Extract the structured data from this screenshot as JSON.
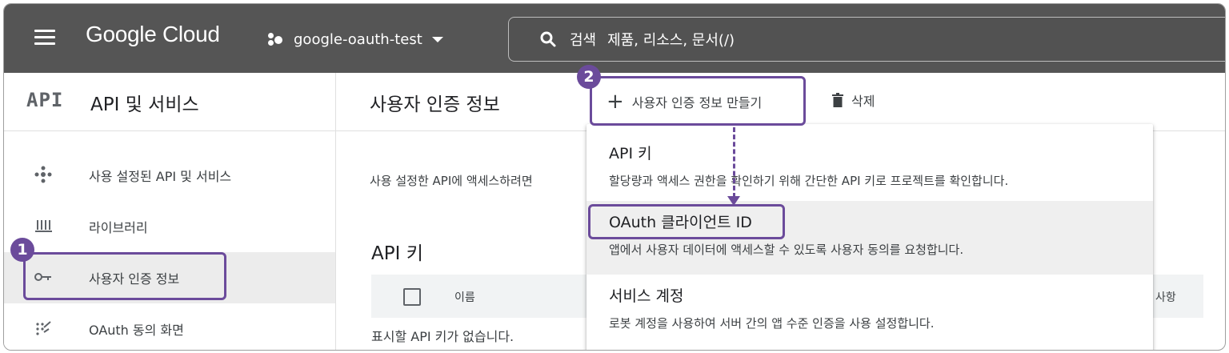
{
  "topbar": {
    "brand": "Google Cloud",
    "project": "google-oauth-test",
    "search_prefix": "검색",
    "search_placeholder": "제품, 리소스, 문서(/)"
  },
  "sidebar": {
    "logo": "API",
    "title": "API 및 서비스",
    "items": [
      {
        "label": "사용 설정된 API 및 서비스",
        "icon": "diamond-icon"
      },
      {
        "label": "라이브러리",
        "icon": "library-icon"
      },
      {
        "label": "사용자 인증 정보",
        "icon": "key-icon"
      },
      {
        "label": "OAuth 동의 화면",
        "icon": "consent-icon"
      }
    ]
  },
  "main": {
    "title": "사용자 인증 정보",
    "create_label": "사용자 인증 정보 만들기",
    "delete_label": "삭제",
    "intro": "사용 설정한 API에 액세스하려면",
    "apikeys_title": "API 키",
    "table": {
      "col_name": "이름",
      "col_note": "사항",
      "empty": "표시할 API 키가 없습니다."
    }
  },
  "menu": {
    "items": [
      {
        "title": "API 키",
        "desc": "할당량과 액세스 권한을 확인하기 위해 간단한 API 키로 프로젝트를 확인합니다."
      },
      {
        "title": "OAuth 클라이언트 ID",
        "desc": "앱에서 사용자 데이터에 액세스할 수 있도록 사용자 동의를 요청합니다."
      },
      {
        "title": "서비스 계정",
        "desc": "로봇 계정을 사용하여 서버 간의 앱 수준 인증을 사용 설정합니다."
      }
    ]
  },
  "annotations": {
    "badge1": "1",
    "badge2": "2",
    "color": "#6b4b9b"
  }
}
